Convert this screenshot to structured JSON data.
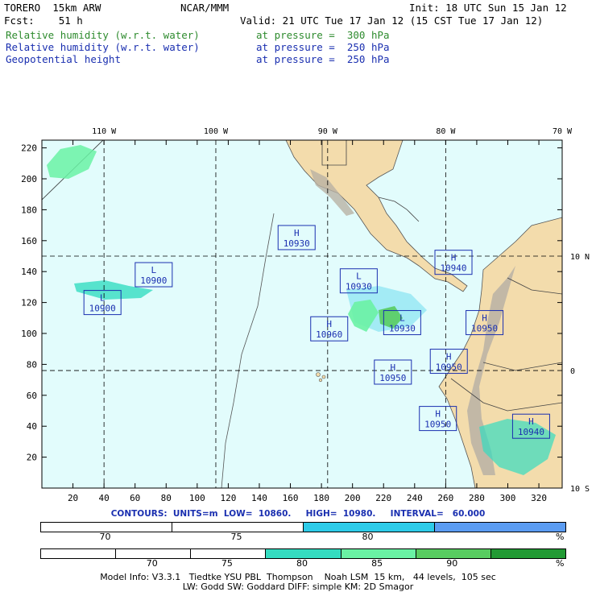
{
  "header": {
    "model": "TORERO  15km ARW",
    "org": "NCAR/MMM",
    "init": "Init: 18 UTC Sun 15 Jan 12",
    "fcst": "Fcst:    51 h",
    "valid": "Valid: 21 UTC Tue 17 Jan 12 (15 CST Tue 17 Jan 12)",
    "fields": [
      {
        "name": "Relative humidity (w.r.t. water)",
        "level": "at pressure =  300 hPa",
        "color": "#2e8b2e"
      },
      {
        "name": "Relative humidity (w.r.t. water)",
        "level": "at pressure =  250 hPa",
        "color": "#1a2fb0"
      },
      {
        "name": "Geopotential height",
        "level": "at pressure =  250 hPa",
        "color": "#1a2fb0"
      }
    ]
  },
  "chart_data": {
    "type": "heatmap",
    "title": "",
    "xlabel": "",
    "ylabel": "",
    "x_ticks": [
      20,
      40,
      60,
      80,
      100,
      120,
      140,
      160,
      180,
      200,
      220,
      240,
      260,
      280,
      300,
      320
    ],
    "y_ticks": [
      20,
      40,
      60,
      80,
      100,
      120,
      140,
      160,
      180,
      200,
      220
    ],
    "xlim": [
      0,
      335
    ],
    "ylim": [
      0,
      225
    ],
    "lon_labels": [
      {
        "text": "110 W",
        "x": 40
      },
      {
        "text": "100 W",
        "x": 112
      },
      {
        "text": "90 W",
        "x": 184
      },
      {
        "text": "80 W",
        "x": 260
      },
      {
        "text": "70 W",
        "x": 335
      }
    ],
    "lat_labels": [
      {
        "text": "10 N",
        "y": 150
      },
      {
        "text": "0",
        "y": 76
      },
      {
        "text": "10 S",
        "y": 0
      }
    ],
    "highs_lows": [
      {
        "type": "H",
        "value": "10930",
        "x": 164,
        "y": 162
      },
      {
        "type": "L",
        "value": "10900",
        "x": 72,
        "y": 138
      },
      {
        "type": "L",
        "value": "10930",
        "x": 204,
        "y": 134
      },
      {
        "type": "L",
        "value": "10900",
        "x": 39,
        "y": 120
      },
      {
        "type": "H",
        "value": "10940",
        "x": 265,
        "y": 146
      },
      {
        "type": "L",
        "value": "10930",
        "x": 232,
        "y": 107
      },
      {
        "type": "H",
        "value": "10960",
        "x": 185,
        "y": 103
      },
      {
        "type": "H",
        "value": "10950",
        "x": 285,
        "y": 107
      },
      {
        "type": "H",
        "value": "10950",
        "x": 262,
        "y": 82
      },
      {
        "type": "H",
        "value": "10950",
        "x": 226,
        "y": 75
      },
      {
        "type": "H",
        "value": "10950",
        "x": 255,
        "y": 45
      },
      {
        "type": "H",
        "value": "10940",
        "x": 315,
        "y": 40
      }
    ],
    "contour_info": {
      "label": "CONTOURS:",
      "units": "UNITS=m",
      "low": "LOW=  10860.",
      "high": "HIGH=  10980.",
      "interval": "INTERVAL=   60.000"
    },
    "legend_250": {
      "ticks": [
        "70",
        "75",
        "80",
        "%"
      ],
      "colors": [
        "#ffffff",
        "#ffffff",
        "#2ecbe8",
        "#5b9cf2"
      ]
    },
    "legend_300": {
      "ticks": [
        "70",
        "75",
        "80",
        "85",
        "90",
        "%"
      ],
      "colors": [
        "#ffffff",
        "#ffffff",
        "#ffffff",
        "#35dcc0",
        "#6af2a4",
        "#58cc60",
        "#229a34"
      ]
    }
  },
  "footer": {
    "line1": "Model Info: V3.3.1   Tiedtke YSU PBL  Thompson    Noah LSM  15 km,   44 levels,  105 sec",
    "line2": "LW: Godd SW: Goddard DIFF: simple KM: 2D Smagor"
  }
}
